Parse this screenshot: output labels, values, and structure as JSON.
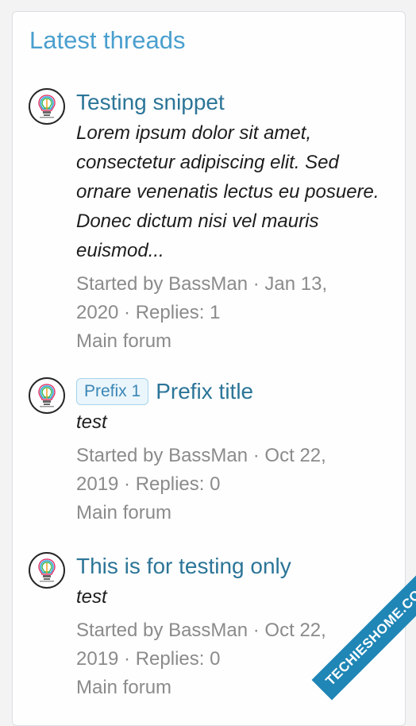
{
  "widget": {
    "title": "Latest threads"
  },
  "threads": [
    {
      "prefix": "",
      "title": "Testing snippet",
      "snippet": "Lorem ipsum dolor sit amet, consectetur adipiscing elit. Sed ornare venenatis lectus eu posuere. Donec dictum nisi vel mauris euismod...",
      "meta_line1": "Started by BassMan · Jan 13,",
      "meta_line2": "2020 · Replies: 1",
      "forum": "Main forum",
      "avatar_icon": "lightbulb-logo-icon"
    },
    {
      "prefix": "Prefix 1",
      "title": "Prefix title",
      "snippet": "test",
      "meta_line1": "Started by BassMan · Oct 22,",
      "meta_line2": "2019 · Replies: 0",
      "forum": "Main forum",
      "avatar_icon": "lightbulb-logo-icon"
    },
    {
      "prefix": "",
      "title": "This is for testing only",
      "snippet": "test",
      "meta_line1": "Started by BassMan · Oct 22,",
      "meta_line2": "2019 · Replies: 0",
      "forum": "Main forum",
      "avatar_icon": "lightbulb-logo-icon"
    }
  ],
  "watermark": {
    "text": "TECHIESHOME.COM"
  },
  "colors": {
    "title": "#4a9fce",
    "link": "#2c7598",
    "muted": "#8b8b8b",
    "watermark": "#1f86b6"
  }
}
